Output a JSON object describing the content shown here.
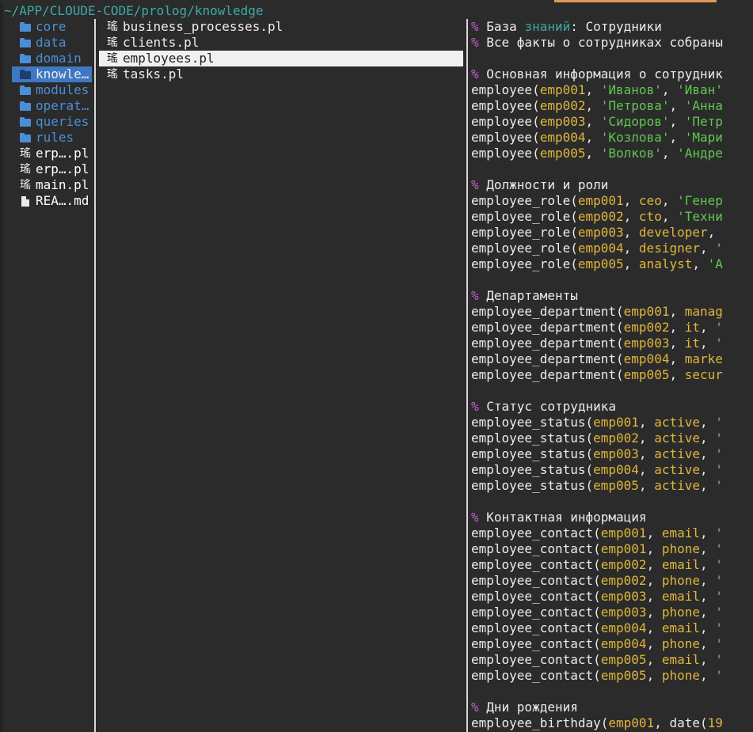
{
  "path": "~/APP/CLOUDE-CODE/prolog/knowledge",
  "colors": {
    "accent": "#e09a53",
    "dir": "#4a8fd6",
    "selected_dir_bg": "#3e78c4",
    "comment": "#c061cb",
    "atom": "#e0b63a",
    "string": "#62c553",
    "path": "#3daaa6"
  },
  "col1": [
    {
      "label": "core",
      "type": "dir",
      "icon": "folder-icon"
    },
    {
      "label": "data",
      "type": "dir",
      "icon": "folder-icon"
    },
    {
      "label": "domain",
      "type": "dir",
      "icon": "folder-icon"
    },
    {
      "label": "knowle…",
      "type": "dir",
      "icon": "folder-icon",
      "selected": true
    },
    {
      "label": "modules",
      "type": "dir",
      "icon": "folder-icon"
    },
    {
      "label": "operat…",
      "type": "dir",
      "icon": "folder-icon"
    },
    {
      "label": "queries",
      "type": "dir",
      "icon": "folder-icon"
    },
    {
      "label": "rules",
      "type": "dir",
      "icon": "folder-icon"
    },
    {
      "label": "erp….pl",
      "type": "file",
      "icon": "prolog-file-icon",
      "glyph": "瑤"
    },
    {
      "label": "erp….pl",
      "type": "file",
      "icon": "prolog-file-icon",
      "glyph": "瑤"
    },
    {
      "label": "main.pl",
      "type": "file",
      "icon": "prolog-file-icon",
      "glyph": "瑤"
    },
    {
      "label": "REA….md",
      "type": "file",
      "icon": "markdown-file-icon"
    }
  ],
  "col2": [
    {
      "label": "business_processes.pl",
      "icon": "prolog-file-icon",
      "glyph": "瑤"
    },
    {
      "label": "clients.pl",
      "icon": "prolog-file-icon",
      "glyph": "瑤"
    },
    {
      "label": "employees.pl",
      "icon": "prolog-file-icon",
      "glyph": "瑤",
      "selected": true
    },
    {
      "label": "tasks.pl",
      "icon": "prolog-file-icon",
      "glyph": "瑤"
    }
  ],
  "preview": [
    [
      [
        "% ",
        "c"
      ],
      [
        "База ",
        "t"
      ],
      [
        "знаний",
        "hl"
      ],
      [
        ": Сотрудники",
        "t"
      ]
    ],
    [
      [
        "% ",
        "c"
      ],
      [
        "Все факты о сотрудниках собраны",
        "t"
      ]
    ],
    [],
    [
      [
        "% ",
        "c"
      ],
      [
        "Основная информация о сотрудник",
        "t"
      ]
    ],
    [
      [
        "employee(",
        "t"
      ],
      [
        "emp001",
        "a"
      ],
      [
        ", ",
        "t"
      ],
      [
        "'Иванов'",
        "s"
      ],
      [
        ", ",
        "t"
      ],
      [
        "'Иван'",
        "s"
      ]
    ],
    [
      [
        "employee(",
        "t"
      ],
      [
        "emp002",
        "a"
      ],
      [
        ", ",
        "t"
      ],
      [
        "'Петрова'",
        "s"
      ],
      [
        ", ",
        "t"
      ],
      [
        "'Анна",
        "s"
      ]
    ],
    [
      [
        "employee(",
        "t"
      ],
      [
        "emp003",
        "a"
      ],
      [
        ", ",
        "t"
      ],
      [
        "'Сидоров'",
        "s"
      ],
      [
        ", ",
        "t"
      ],
      [
        "'Петр",
        "s"
      ]
    ],
    [
      [
        "employee(",
        "t"
      ],
      [
        "emp004",
        "a"
      ],
      [
        ", ",
        "t"
      ],
      [
        "'Козлова'",
        "s"
      ],
      [
        ", ",
        "t"
      ],
      [
        "'Мари",
        "s"
      ]
    ],
    [
      [
        "employee(",
        "t"
      ],
      [
        "emp005",
        "a"
      ],
      [
        ", ",
        "t"
      ],
      [
        "'Волков'",
        "s"
      ],
      [
        ", ",
        "t"
      ],
      [
        "'Андре",
        "s"
      ]
    ],
    [],
    [
      [
        "% ",
        "c"
      ],
      [
        "Должности и роли",
        "t"
      ]
    ],
    [
      [
        "employee_role(",
        "t"
      ],
      [
        "emp001",
        "a"
      ],
      [
        ", ",
        "t"
      ],
      [
        "ceo",
        "a"
      ],
      [
        ", ",
        "t"
      ],
      [
        "'Генер",
        "s"
      ]
    ],
    [
      [
        "employee_role(",
        "t"
      ],
      [
        "emp002",
        "a"
      ],
      [
        ", ",
        "t"
      ],
      [
        "cto",
        "a"
      ],
      [
        ", ",
        "t"
      ],
      [
        "'Техни",
        "s"
      ]
    ],
    [
      [
        "employee_role(",
        "t"
      ],
      [
        "emp003",
        "a"
      ],
      [
        ", ",
        "t"
      ],
      [
        "developer",
        "a"
      ],
      [
        ",",
        "t"
      ]
    ],
    [
      [
        "employee_role(",
        "t"
      ],
      [
        "emp004",
        "a"
      ],
      [
        ", ",
        "t"
      ],
      [
        "designer",
        "a"
      ],
      [
        ", ",
        "t"
      ],
      [
        "'",
        "s"
      ]
    ],
    [
      [
        "employee_role(",
        "t"
      ],
      [
        "emp005",
        "a"
      ],
      [
        ", ",
        "t"
      ],
      [
        "analyst",
        "a"
      ],
      [
        ", ",
        "t"
      ],
      [
        "'А",
        "s"
      ]
    ],
    [],
    [
      [
        "% ",
        "c"
      ],
      [
        "Департаменты",
        "t"
      ]
    ],
    [
      [
        "employee_department(",
        "t"
      ],
      [
        "emp001",
        "a"
      ],
      [
        ", ",
        "t"
      ],
      [
        "manag",
        "a"
      ]
    ],
    [
      [
        "employee_department(",
        "t"
      ],
      [
        "emp002",
        "a"
      ],
      [
        ", ",
        "t"
      ],
      [
        "it",
        "a"
      ],
      [
        ", ",
        "t"
      ],
      [
        "'",
        "s"
      ]
    ],
    [
      [
        "employee_department(",
        "t"
      ],
      [
        "emp003",
        "a"
      ],
      [
        ", ",
        "t"
      ],
      [
        "it",
        "a"
      ],
      [
        ", ",
        "t"
      ],
      [
        "'",
        "s"
      ]
    ],
    [
      [
        "employee_department(",
        "t"
      ],
      [
        "emp004",
        "a"
      ],
      [
        ", ",
        "t"
      ],
      [
        "marke",
        "a"
      ]
    ],
    [
      [
        "employee_department(",
        "t"
      ],
      [
        "emp005",
        "a"
      ],
      [
        ", ",
        "t"
      ],
      [
        "secur",
        "a"
      ]
    ],
    [],
    [
      [
        "% ",
        "c"
      ],
      [
        "Статус сотрудника",
        "t"
      ]
    ],
    [
      [
        "employee_status(",
        "t"
      ],
      [
        "emp001",
        "a"
      ],
      [
        ", ",
        "t"
      ],
      [
        "active",
        "a"
      ],
      [
        ", ",
        "t"
      ],
      [
        "'",
        "s"
      ]
    ],
    [
      [
        "employee_status(",
        "t"
      ],
      [
        "emp002",
        "a"
      ],
      [
        ", ",
        "t"
      ],
      [
        "active",
        "a"
      ],
      [
        ", ",
        "t"
      ],
      [
        "'",
        "s"
      ]
    ],
    [
      [
        "employee_status(",
        "t"
      ],
      [
        "emp003",
        "a"
      ],
      [
        ", ",
        "t"
      ],
      [
        "active",
        "a"
      ],
      [
        ", ",
        "t"
      ],
      [
        "'",
        "s"
      ]
    ],
    [
      [
        "employee_status(",
        "t"
      ],
      [
        "emp004",
        "a"
      ],
      [
        ", ",
        "t"
      ],
      [
        "active",
        "a"
      ],
      [
        ", ",
        "t"
      ],
      [
        "'",
        "s"
      ]
    ],
    [
      [
        "employee_status(",
        "t"
      ],
      [
        "emp005",
        "a"
      ],
      [
        ", ",
        "t"
      ],
      [
        "active",
        "a"
      ],
      [
        ", ",
        "t"
      ],
      [
        "'",
        "s"
      ]
    ],
    [],
    [
      [
        "% ",
        "c"
      ],
      [
        "Контактная информация",
        "t"
      ]
    ],
    [
      [
        "employee_contact(",
        "t"
      ],
      [
        "emp001",
        "a"
      ],
      [
        ", ",
        "t"
      ],
      [
        "email",
        "a"
      ],
      [
        ", ",
        "t"
      ],
      [
        "'",
        "s"
      ]
    ],
    [
      [
        "employee_contact(",
        "t"
      ],
      [
        "emp001",
        "a"
      ],
      [
        ", ",
        "t"
      ],
      [
        "phone",
        "a"
      ],
      [
        ", ",
        "t"
      ],
      [
        "'",
        "s"
      ]
    ],
    [
      [
        "employee_contact(",
        "t"
      ],
      [
        "emp002",
        "a"
      ],
      [
        ", ",
        "t"
      ],
      [
        "email",
        "a"
      ],
      [
        ", ",
        "t"
      ],
      [
        "'",
        "s"
      ]
    ],
    [
      [
        "employee_contact(",
        "t"
      ],
      [
        "emp002",
        "a"
      ],
      [
        ", ",
        "t"
      ],
      [
        "phone",
        "a"
      ],
      [
        ", ",
        "t"
      ],
      [
        "'",
        "s"
      ]
    ],
    [
      [
        "employee_contact(",
        "t"
      ],
      [
        "emp003",
        "a"
      ],
      [
        ", ",
        "t"
      ],
      [
        "email",
        "a"
      ],
      [
        ", ",
        "t"
      ],
      [
        "'",
        "s"
      ]
    ],
    [
      [
        "employee_contact(",
        "t"
      ],
      [
        "emp003",
        "a"
      ],
      [
        ", ",
        "t"
      ],
      [
        "phone",
        "a"
      ],
      [
        ", ",
        "t"
      ],
      [
        "'",
        "s"
      ]
    ],
    [
      [
        "employee_contact(",
        "t"
      ],
      [
        "emp004",
        "a"
      ],
      [
        ", ",
        "t"
      ],
      [
        "email",
        "a"
      ],
      [
        ", ",
        "t"
      ],
      [
        "'",
        "s"
      ]
    ],
    [
      [
        "employee_contact(",
        "t"
      ],
      [
        "emp004",
        "a"
      ],
      [
        ", ",
        "t"
      ],
      [
        "phone",
        "a"
      ],
      [
        ", ",
        "t"
      ],
      [
        "'",
        "s"
      ]
    ],
    [
      [
        "employee_contact(",
        "t"
      ],
      [
        "emp005",
        "a"
      ],
      [
        ", ",
        "t"
      ],
      [
        "email",
        "a"
      ],
      [
        ", ",
        "t"
      ],
      [
        "'",
        "s"
      ]
    ],
    [
      [
        "employee_contact(",
        "t"
      ],
      [
        "emp005",
        "a"
      ],
      [
        ", ",
        "t"
      ],
      [
        "phone",
        "a"
      ],
      [
        ", ",
        "t"
      ],
      [
        "'",
        "s"
      ]
    ],
    [],
    [
      [
        "% ",
        "c"
      ],
      [
        "Дни рождения",
        "t"
      ]
    ],
    [
      [
        "employee_birthday(",
        "t"
      ],
      [
        "emp001",
        "a"
      ],
      [
        ", ",
        "t"
      ],
      [
        "date(",
        "t"
      ],
      [
        "19",
        "a"
      ]
    ]
  ]
}
